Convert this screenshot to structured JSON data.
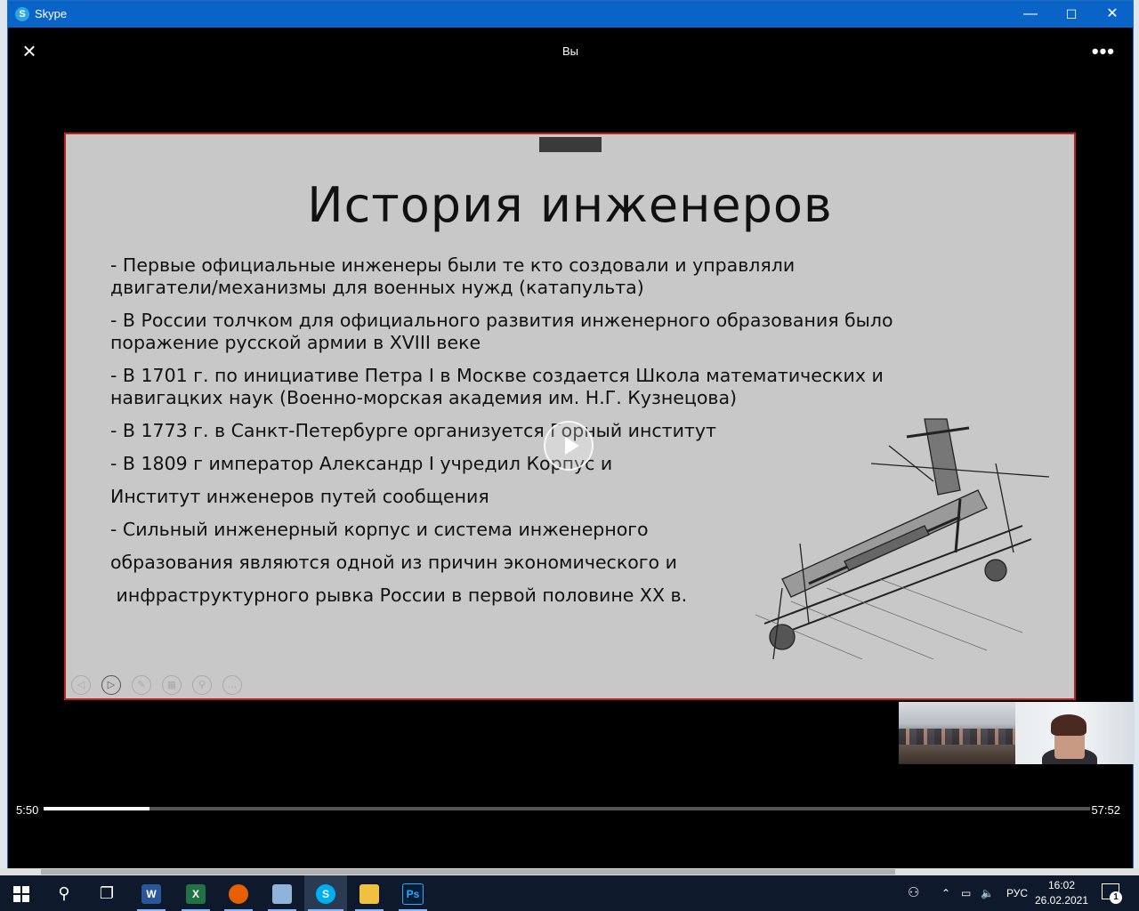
{
  "window": {
    "app_title": "Skype",
    "minimize": "—",
    "maximize": "☐",
    "close": "✕"
  },
  "viewer": {
    "title": "Вы",
    "close_label": "×",
    "more_label": "•••"
  },
  "slide": {
    "title": "История инженеров",
    "paragraphs": [
      "- Первые официальные инженеры были те кто создовали и управляли двигатели/механизмы для военных нужд (катапульта)",
      "- В России толчком для официального развития инженерного образования было поражение русской армии в XVIII веке",
      "- В 1701 г. по инициативе Петра I в Москве создается Школа математических и навигацких наук (Военно-морская академия им. Н.Г. Кузнецова)",
      "- В 1773 г. в Санкт-Петербурге организуется Горный институт",
      "- В 1809 г император Александр I учредил Корпус и",
      "Институт инженеров путей сообщения",
      "- Сильный инженерный корпус и система инженерного",
      "образования являются одной из причин экономического и",
      " инфраструктурного рывка России в первой половине XX в."
    ]
  },
  "playback": {
    "current_time": "5:50",
    "total_time": "57:52",
    "progress": 0.101
  },
  "taskbar": {
    "language": "РУС",
    "time": "16:02",
    "date": "26.02.2021",
    "notification_count": "1",
    "apps": {
      "word": "W",
      "excel": "X",
      "skype": "S",
      "photoshop": "Ps"
    }
  },
  "colors": {
    "titlebar": "#0a64c8",
    "slide_border": "#c0201c",
    "slide_bg": "#c8c8c8",
    "taskbar": "#0e1a2b"
  }
}
